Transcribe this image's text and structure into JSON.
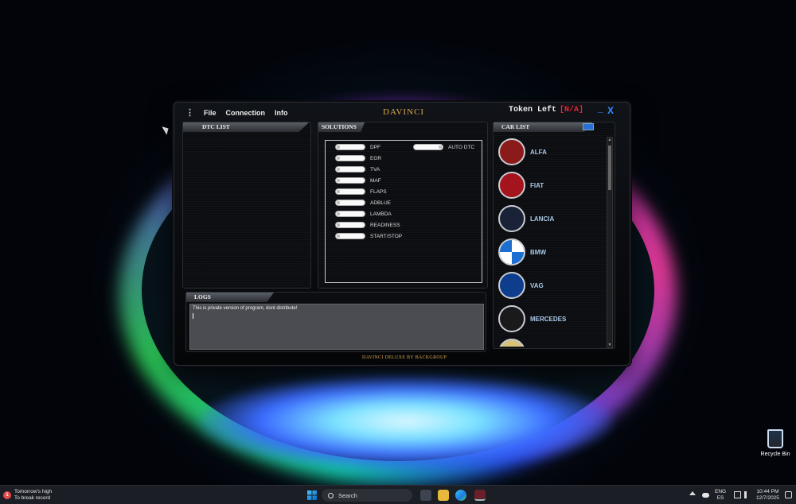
{
  "app": {
    "menu": [
      "File",
      "Connection",
      "Info"
    ],
    "title": "DAVINCI",
    "token_label": "Token Left",
    "token_value": "[N/A]",
    "minimize": "_",
    "close": "X",
    "footer": "DAVINCI DELUXE BY BACKGROUP"
  },
  "dtc": {
    "header": "DTC LIST"
  },
  "solutions": {
    "header": "SOLUTIONS",
    "items": [
      "DPF",
      "EGR",
      "TVA",
      "MAF",
      "FLAPS",
      "ADBLUE",
      "LAMBDA",
      "READINESS",
      "START/STOP"
    ],
    "auto_dtc": "AUTO DTC"
  },
  "logs": {
    "header": "LOGS",
    "text": "This is private version of program, dont distribute!"
  },
  "cars": {
    "header": "CAR LIST",
    "items": [
      {
        "name": "ALFA",
        "icon": "alfa-romeo-logo-icon",
        "color": "#8b1a1a"
      },
      {
        "name": "FIAT",
        "icon": "fiat-logo-icon",
        "color": "#a3141c"
      },
      {
        "name": "LANCIA",
        "icon": "lancia-logo-icon",
        "color": "#1a2238"
      },
      {
        "name": "BMW",
        "icon": "bmw-logo-icon",
        "color": "#1c6fd0"
      },
      {
        "name": "VAG",
        "icon": "vw-logo-icon",
        "color": "#0d3d8c"
      },
      {
        "name": "MERCEDES",
        "icon": "mercedes-logo-icon",
        "color": "#1a1a1a"
      }
    ]
  },
  "desktop": {
    "recycle_bin": "Recycle Bin"
  },
  "taskbar": {
    "weather_line1": "Tomorrow's high",
    "weather_line2": "To break record",
    "weather_badge": "1",
    "search": "Search",
    "lang1": "ENG",
    "lang2": "ES",
    "time": "10:44 PM",
    "date": "12/7/2025"
  }
}
